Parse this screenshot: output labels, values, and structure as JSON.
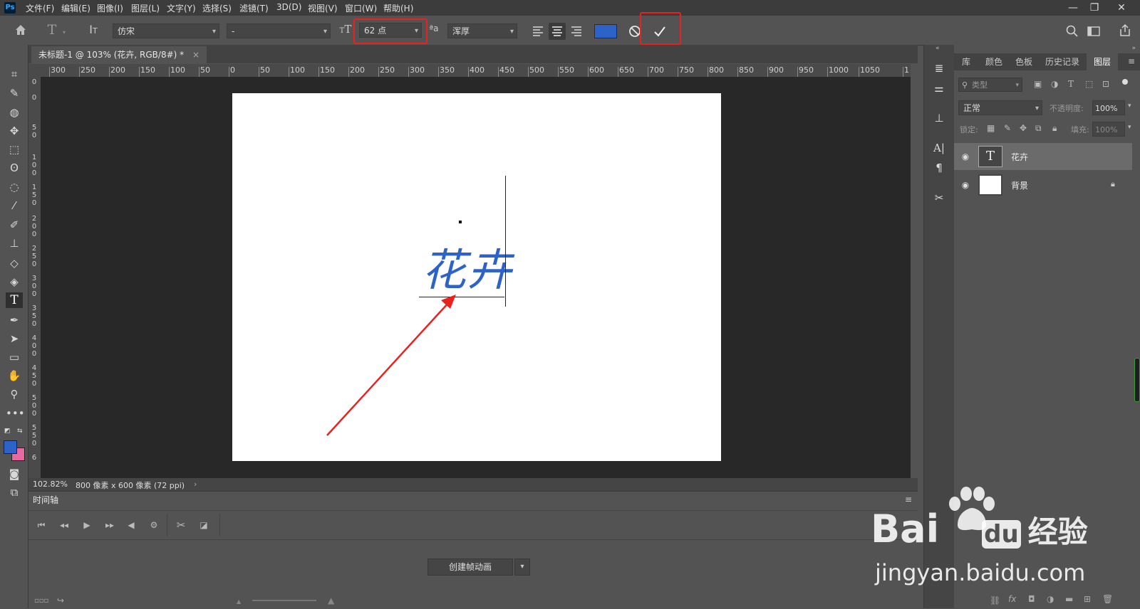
{
  "app": {
    "logo": "Ps"
  },
  "menu": [
    "文件(F)",
    "编辑(E)",
    "图像(I)",
    "图层(L)",
    "文字(Y)",
    "选择(S)",
    "滤镜(T)",
    "3D(D)",
    "视图(V)",
    "窗口(W)",
    "帮助(H)"
  ],
  "window_controls": {
    "minimize": "—",
    "restore": "❐",
    "close": "✕"
  },
  "options": {
    "font_family": "仿宋",
    "font_style": "-",
    "font_size": "62 点",
    "antialias_label": "ªa",
    "antialias": "浑厚",
    "text_color": "#2d63c8"
  },
  "document": {
    "tab_title": "未标题-1 @ 103% (花卉, RGB/8#) *",
    "canvas_text": "花卉"
  },
  "rulers": {
    "h_ticks": [
      "300",
      "250",
      "200",
      "150",
      "100",
      "50",
      "0",
      "50",
      "100",
      "150",
      "200",
      "250",
      "300",
      "350",
      "400",
      "450",
      "500",
      "550",
      "600",
      "650",
      "700",
      "750",
      "800",
      "850",
      "900",
      "950",
      "1000",
      "1050",
      "1"
    ],
    "v_ticks": [
      "0",
      "0",
      "5\n0",
      "1\n0\n0",
      "1\n5\n0",
      "2\n0\n0",
      "2\n5\n0",
      "3\n0\n0",
      "3\n5\n0",
      "4\n0\n0",
      "4\n5\n0",
      "5\n0\n0",
      "5\n5\n0",
      "6"
    ]
  },
  "status": {
    "zoom": "102.82%",
    "doc_info": "800 像素 x 600 像素 (72 ppi)"
  },
  "timeline": {
    "tab": "时间轴",
    "create_button": "创建帧动画"
  },
  "panels": {
    "tabs": [
      "库",
      "颜色",
      "色板",
      "历史记录",
      "图层"
    ],
    "active_tab": "图层",
    "filter_kind": "类型",
    "blend_mode": "正常",
    "opacity_label": "不透明度:",
    "opacity_value": "100%",
    "lock_label": "锁定:",
    "fill_label": "填充:",
    "fill_value": "100%"
  },
  "layers": [
    {
      "name": "花卉",
      "type": "text",
      "selected": true
    },
    {
      "name": "背景",
      "type": "background",
      "selected": false,
      "locked": true
    }
  ],
  "watermark": {
    "brand": "Bai",
    "brand_du": "du",
    "brand_cn": "经验",
    "url": "jingyan.baidu.com"
  }
}
